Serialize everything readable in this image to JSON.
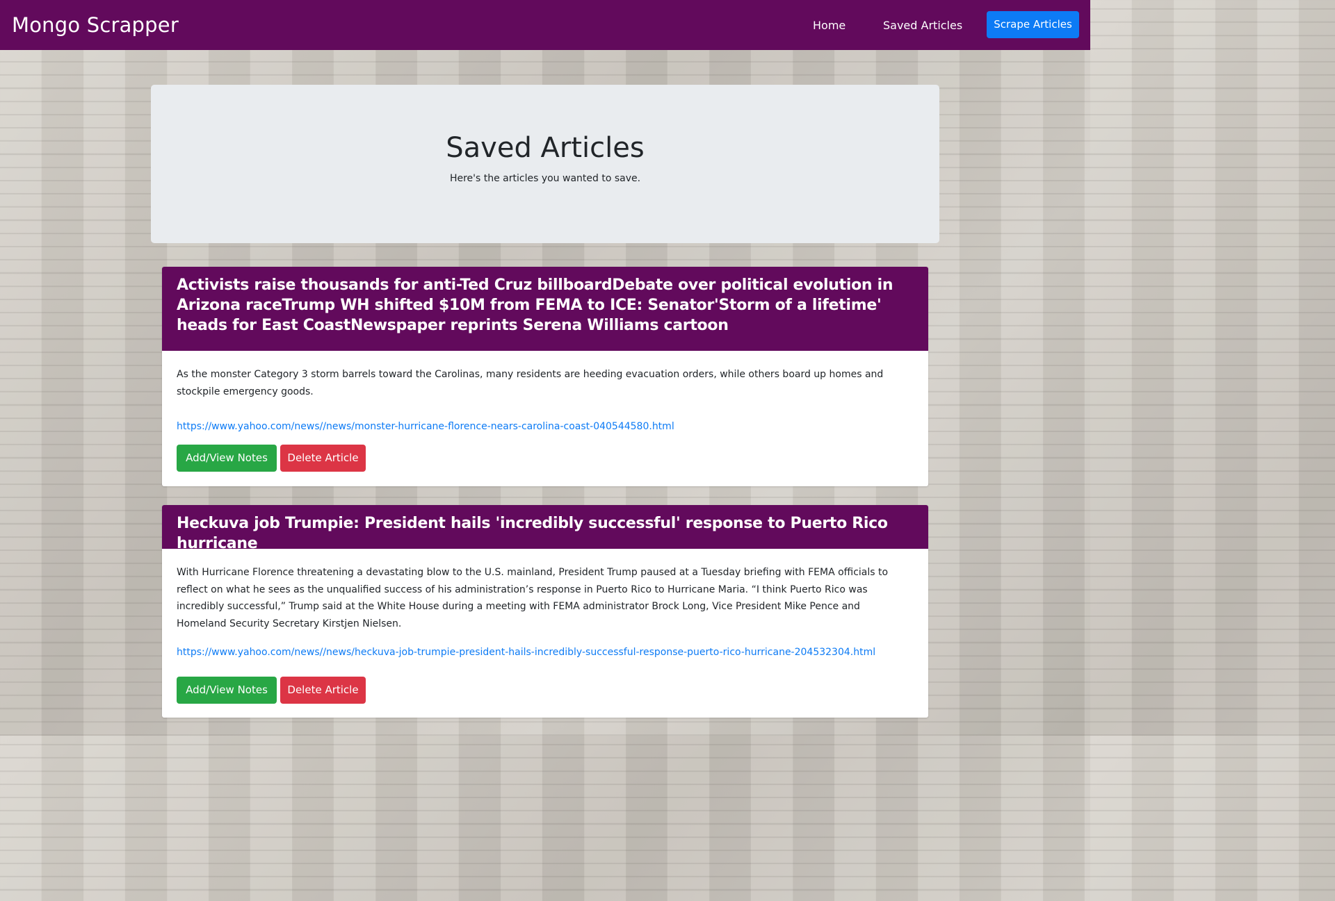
{
  "navbar": {
    "brand": "Mongo Scrapper",
    "links": [
      {
        "label": "Home"
      },
      {
        "label": "Saved Articles"
      }
    ],
    "scrape_button": "Scrape Articles"
  },
  "jumbotron": {
    "title": "Saved Articles",
    "subtitle": "Here's the articles you wanted to save."
  },
  "articles": [
    {
      "headline": "Activists raise thousands for anti-Ted Cruz billboardDebate over political evolution in Arizona raceTrump WH shifted $10M from FEMA to ICE: Senator'Storm of a lifetime' heads for East CoastNewspaper reprints Serena Williams cartoon",
      "summary": "As the monster Category 3 storm barrels toward the Carolinas, many residents are heeding evacuation orders, while others board up homes and stockpile emergency goods.",
      "link": "https://www.yahoo.com/news//news/monster-hurricane-florence-nears-carolina-coast-040544580.html",
      "notes_button": "Add/View Notes",
      "delete_button": "Delete Article"
    },
    {
      "headline": "Heckuva job Trumpie: President hails 'incredibly successful' response to Puerto Rico hurricane",
      "summary": "With Hurricane Florence threatening a devastating blow to the U.S. mainland, President Trump paused at a Tuesday briefing with FEMA officials to reflect on what he sees as the unqualified success of his administration’s response in Puerto Rico to Hurricane Maria. “I think Puerto Rico was incredibly successful,” Trump said at the White House during a meeting with FEMA administrator Brock Long, Vice President Mike Pence and Homeland Security Secretary Kirstjen Nielsen.",
      "link": "https://www.yahoo.com/news//news/heckuva-job-trumpie-president-hails-incredibly-successful-response-puerto-rico-hurricane-204532304.html",
      "notes_button": "Add/View Notes",
      "delete_button": "Delete Article"
    }
  ],
  "colors": {
    "navbar": "#620a5c",
    "card_header": "#620a5c",
    "primary": "#0d7bf5",
    "success": "#28a745",
    "danger": "#dc3545",
    "jumbotron": "#e9ecef"
  }
}
